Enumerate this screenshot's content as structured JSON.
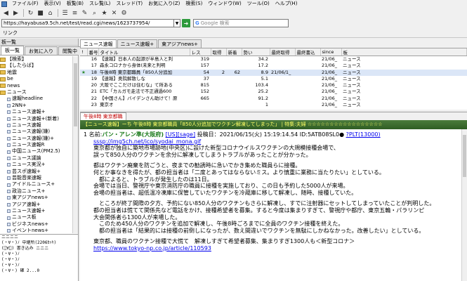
{
  "menubar": {
    "items": [
      "ファイル(F)",
      "表示(V)",
      "板覧(B)",
      "スレ覧(L)",
      "スレッド(T)",
      "お気に入り(Z)",
      "検索(S)",
      "ウィンドウ(W)",
      "ツール(O)",
      "ヘルプ(H)"
    ]
  },
  "toolbar": {
    "buttons": [
      "back-icon",
      "forward-icon",
      "reload-icon",
      "stop-icon",
      "home-icon",
      "board-list-icon",
      "thread-list-icon",
      "write-icon",
      "search-icon",
      "favorite-icon",
      "delete-icon",
      "settings-icon"
    ]
  },
  "addressbar": {
    "url": "https://hayabusa9.5ch.net/test/read.cgi/news/1623737954/",
    "search_placeholder": "Google 検索"
  },
  "linkbar": {
    "label": "リンク"
  },
  "leftpane": {
    "title": "板一覧",
    "tabs": [
      "板一覧",
      "お気に入り",
      "閲覧中"
    ],
    "tree": [
      {
        "type": "folder",
        "label": "【検索】"
      },
      {
        "type": "folder",
        "label": "【したらば】"
      },
      {
        "type": "folder",
        "label": "地震"
      },
      {
        "type": "folder",
        "label": "be"
      },
      {
        "type": "folder",
        "label": "news"
      },
      {
        "type": "folder",
        "label": "ニュース"
      },
      {
        "type": "board",
        "label": "速報headline"
      },
      {
        "type": "board",
        "label": "2NN+"
      },
      {
        "type": "board",
        "label": "ニュース速報+"
      },
      {
        "type": "board",
        "label": "ニュース速報+(新着)"
      },
      {
        "type": "board",
        "label": "ニュース速報"
      },
      {
        "type": "board",
        "label": "ニュース速報(嫌)"
      },
      {
        "type": "board",
        "label": "ニュース速報(嫌)+"
      },
      {
        "type": "board",
        "label": "ニュース速報R"
      },
      {
        "type": "board",
        "label": "中国ニュース(PM2.5)"
      },
      {
        "type": "board",
        "label": "ニュース議論"
      },
      {
        "type": "board",
        "label": "ニュース実況+"
      },
      {
        "type": "board",
        "label": "芸スポ速報+"
      },
      {
        "type": "board",
        "label": "芸能音楽速報"
      },
      {
        "type": "board",
        "label": "アイドルニュース+"
      },
      {
        "type": "board",
        "label": "政治ニュース+"
      },
      {
        "type": "board",
        "label": "東アジアnews+"
      },
      {
        "type": "board",
        "label": "アジア速報+"
      },
      {
        "type": "board",
        "label": "ニュース速報+"
      },
      {
        "type": "board",
        "label": "ニュース板"
      },
      {
        "type": "board",
        "label": "ビジネスnews+"
      },
      {
        "type": "board",
        "label": "イベントnews+"
      },
      {
        "type": "board",
        "label": "科学ニュース+"
      },
      {
        "type": "board",
        "label": "PINKニュース+"
      },
      {
        "type": "board",
        "label": "AV+"
      },
      {
        "type": "board",
        "label": "ENSニュース+"
      }
    ],
    "history": [
      "ニニニニ",
      "(・∀・)ﾉ 中継所(2206ｶｯｷ)",
      "(ﾟ∀ﾟ) 書き込み ニニニ",
      "(・∀・)ﾉ",
      "(・∀・)ﾉ",
      "(・∀・)ﾉ",
      "(・∀・) 確 2...0"
    ]
  },
  "board_tabs": [
    "ニュース速報",
    "ニュース速報+",
    "東アジアnews+"
  ],
  "thread_list": {
    "columns": [
      "!",
      "番号",
      "タイトル",
      "レス",
      "取得",
      "新着",
      "勢い",
      "最終取得",
      "最終書込",
      "since",
      "板"
    ],
    "rows": [
      {
        "mark": "",
        "no": "16",
        "title": "【速報】日本人の起源が半島人と判",
        "res": "319",
        "got": "",
        "new": "",
        "speed": "34.2",
        "last_get": "",
        "last_write": "",
        "since": "21/06_",
        "board": "ニュース"
      },
      {
        "mark": "",
        "no": "17",
        "title": "森永コロナから身体(未来と判明",
        "res": "157",
        "got": "",
        "new": "",
        "speed": "17.2",
        "last_get": "",
        "last_write": "",
        "since": "21/06_",
        "board": "ニュース"
      },
      {
        "mark": "★",
        "no": "18",
        "title": "午後8時 東京都職員「850人分追加",
        "res": "54",
        "got": "2",
        "new": "62",
        "speed": "8.9",
        "last_get": "21/06/1_",
        "last_write": "",
        "since": "21/06_",
        "board": "ニュース"
      },
      {
        "mark": "",
        "no": "19",
        "title": "【速報】奥院解散しな",
        "res": "37",
        "got": "",
        "new": "",
        "speed": "5.1",
        "last_get": "",
        "last_write": "",
        "since": "21/06_",
        "board": "ニュース"
      },
      {
        "mark": "",
        "no": "20",
        "title": "大阪でここだけは住むな」て所ある",
        "res": "815",
        "got": "",
        "new": "",
        "speed": "103.4",
        "last_get": "",
        "last_write": "",
        "since": "21/06_",
        "board": "ニュース"
      },
      {
        "mark": "",
        "no": "21",
        "title": "ETC「カルガモ走法で不正通過600",
        "res": "152",
        "got": "",
        "new": "",
        "speed": "25.2",
        "last_get": "",
        "last_write": "",
        "since": "21/06_",
        "board": "ニュース"
      },
      {
        "mark": "",
        "no": "22",
        "title": "【中国さん】バイデンさん助けて！原",
        "res": "665",
        "got": "",
        "new": "",
        "speed": "91.2",
        "last_get": "",
        "last_write": "",
        "since": "21/06_",
        "board": "ニュース"
      },
      {
        "mark": "",
        "no": "23",
        "title": "東京オ",
        "res": "",
        "got": "",
        "new": "",
        "speed": "1",
        "last_get": "",
        "last_write": "",
        "since": "21/06_",
        "board": "ニュース"
      }
    ]
  },
  "thread_tabs": [
    "午後8時 東京都職"
  ],
  "thread_title": "【ニュース速報】ーち 午後8時 東京都職員「850人分追加でワクチン解凍してしまった」 | 特集:夫婦 ☆☆☆☆☆☆☆☆☆☆☆☆☆☆☆☆☆",
  "post": {
    "number": "1",
    "name_label": "名前:",
    "name": "パン・アレン準(大阪府)",
    "mail": "[US][sage]",
    "date": "投稿日：2021/06/15(火) 15:19:14.54",
    "id": "ID:5ATB08SL0●",
    "be": "?PLT(13000)",
    "icon_link": "sssp://img5ch.net/ico/syodai_mona.gif",
    "lines": [
      "東京都が独自に築地市場跡地(中央区)に設けた新型コロナウイルスワクチンの大規模接種会場で、",
      "誤って850人分のワクチンを余分に解凍してしまうトラブルがあったことが分かった。",
      "",
      "都はワクチン廃棄を防ごうと、夜までの勧誘時に急いでかき集めた職員らに接種。",
      "何とか事なきを得たが、都の担当者は「二度とあってはならないミス。より慎重に業務に当たりたい」としている。",
      "　都によると、トラブルが発生したのは11日。",
      "会場では当日、警視庁や東京消防庁の職員に接種を実施しており、この日も予約した5000人が来場。",
      "会場の担当者は、超低温冷凍庫に保管していたワクチンを冷蔵庫に移して解凍し、随時、接種していた。",
      "",
      "　ところが終了間際の夕方、予約にない850人分のワクチンもさらに解凍し、すでに注射器にセットしてしまっていたことが判明した。",
      "都の担当者は慌てて関係先など電話をかけ、接種希望者を募集。すると今度は集まりすぎて、警視庁や都庁、東京五輪・パラリンピ",
      "大会関係者ら1300人が来場した。",
      "　このため450人分のワクチンを追加で解凍し、午後8時ごろまでに全員のワクチン接種を終えた。",
      "　都の担当者は「結果的には接種の前倒しになったが、数え間違いでワクチンを無駄にしかねなかった。改善したい」としている。",
      "",
      "東京都、職員のワクチン接種で大慌て　解凍しすぎて希望者募集、集まりすぎ1300人も＜新型コロナ＞"
    ],
    "source_link": "https://www.tokyo-np.co.jp/article/110593"
  },
  "colors": {
    "accent": "#2f5d24",
    "link": "#0000ee",
    "name": "#1a7a1a"
  }
}
